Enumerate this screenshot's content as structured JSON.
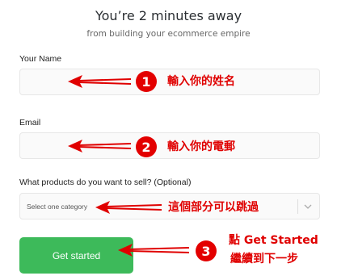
{
  "header": {
    "title": "You’re 2 minutes away",
    "subtitle": "from building your ecommerce empire"
  },
  "form": {
    "name_label": "Your Name",
    "name_value": "",
    "email_label": "Email",
    "email_value": "",
    "products_label": "What products do you want to sell? (Optional)",
    "products_selected": "Select one category",
    "submit_label": "Get started"
  },
  "annotations": {
    "step1_number": "1",
    "step1_text": "輸入你的姓名",
    "step2_number": "2",
    "step2_text": "輸入你的電郵",
    "step_optional_text": "這個部分可以跳過",
    "step3_number": "3",
    "step3_line1": "點 Get Started",
    "step3_line2": "繼續到下一步",
    "color": "#e00000"
  },
  "colors": {
    "button": "#3dba5a",
    "field_bg": "#fafafa",
    "field_border": "#e7e7e7"
  }
}
